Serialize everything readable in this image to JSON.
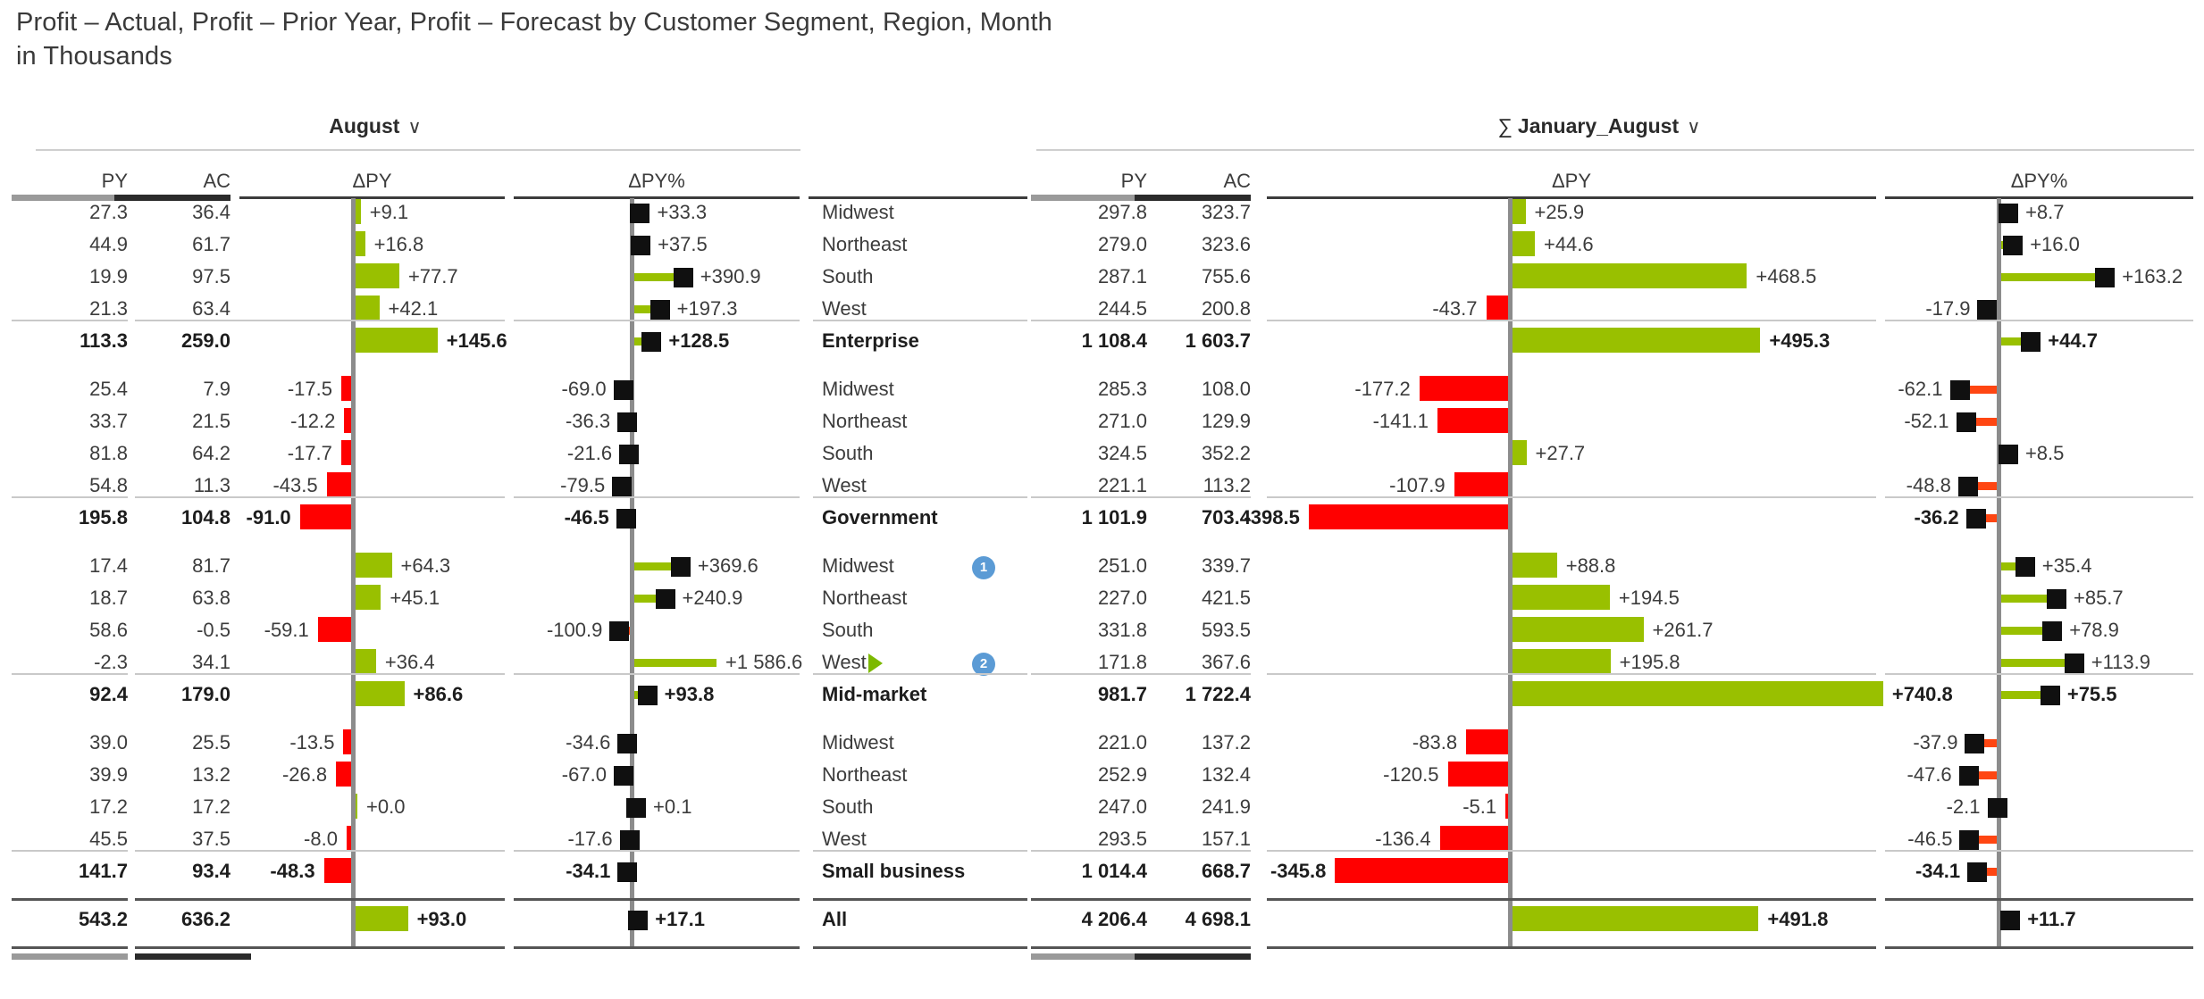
{
  "title": "Profit – Actual, Profit – Prior Year, Profit – Forecast by Customer Segment, Region, Month\nin Thousands",
  "panels": {
    "left": {
      "period_label": "August",
      "chevron": "∨",
      "sigma": "",
      "columns": {
        "py": "PY",
        "ac": "AC",
        "dpy": "ΔPY",
        "dpypct": "ΔPY%"
      }
    },
    "right": {
      "period_label": "January_August",
      "chevron": "∨",
      "sigma": "∑",
      "columns": {
        "py": "PY",
        "ac": "AC",
        "dpy": "ΔPY",
        "dpypct": "ΔPY%"
      }
    }
  },
  "chart_data": {
    "type": "bar",
    "title": "Profit – Actual, Profit – Prior Year, Profit – Forecast by Customer Segment, Region, Month",
    "subtitle": "in Thousands",
    "measures": [
      "PY",
      "AC",
      "ΔPY",
      "ΔPY%"
    ],
    "periods": [
      "August",
      "∑ January_August"
    ],
    "axis_ranges": {
      "left_dpy": [
        -100,
        160
      ],
      "left_dpypct": [
        -110,
        420
      ],
      "right_dpy": [
        -420,
        760
      ],
      "right_dpypct": [
        -70,
        175
      ]
    },
    "groups": [
      {
        "name": "Enterprise",
        "rows": [
          {
            "region": "Midwest",
            "badge": "",
            "aug_py": "27.3",
            "aug_ac": "36.4",
            "aug_dpy": "+9.1",
            "aug_dpy_v": 9.1,
            "aug_pct": "+33.3",
            "aug_pct_v": 33.3,
            "ytd_py": "297.8",
            "ytd_ac": "323.7",
            "ytd_dpy": "+25.9",
            "ytd_dpy_v": 25.9,
            "ytd_pct": "+8.7",
            "ytd_pct_v": 8.7
          },
          {
            "region": "Northeast",
            "badge": "",
            "aug_py": "44.9",
            "aug_ac": "61.7",
            "aug_dpy": "+16.8",
            "aug_dpy_v": 16.8,
            "aug_pct": "+37.5",
            "aug_pct_v": 37.5,
            "ytd_py": "279.0",
            "ytd_ac": "323.6",
            "ytd_dpy": "+44.6",
            "ytd_dpy_v": 44.6,
            "ytd_pct": "+16.0",
            "ytd_pct_v": 16.0
          },
          {
            "region": "South",
            "badge": "",
            "aug_py": "19.9",
            "aug_ac": "97.5",
            "aug_dpy": "+77.7",
            "aug_dpy_v": 77.7,
            "aug_pct": "+390.9",
            "aug_pct_v": 390.9,
            "ytd_py": "287.1",
            "ytd_ac": "755.6",
            "ytd_dpy": "+468.5",
            "ytd_dpy_v": 468.5,
            "ytd_pct": "+163.2",
            "ytd_pct_v": 163.2
          },
          {
            "region": "West",
            "badge": "",
            "aug_py": "21.3",
            "aug_ac": "63.4",
            "aug_dpy": "+42.1",
            "aug_dpy_v": 42.1,
            "aug_pct": "+197.3",
            "aug_pct_v": 197.3,
            "ytd_py": "244.5",
            "ytd_ac": "200.8",
            "ytd_dpy": "-43.7",
            "ytd_dpy_v": -43.7,
            "ytd_pct": "-17.9",
            "ytd_pct_v": -17.9
          }
        ],
        "total": {
          "label": "Enterprise",
          "aug_py": "113.3",
          "aug_ac": "259.0",
          "aug_dpy": "+145.6",
          "aug_dpy_v": 145.6,
          "aug_pct": "+128.5",
          "aug_pct_v": 128.5,
          "ytd_py": "1 108.4",
          "ytd_ac": "1 603.7",
          "ytd_dpy": "+495.3",
          "ytd_dpy_v": 495.3,
          "ytd_pct": "+44.7",
          "ytd_pct_v": 44.7
        }
      },
      {
        "name": "Government",
        "rows": [
          {
            "region": "Midwest",
            "badge": "",
            "aug_py": "25.4",
            "aug_ac": "7.9",
            "aug_dpy": "-17.5",
            "aug_dpy_v": -17.5,
            "aug_pct": "-69.0",
            "aug_pct_v": -69.0,
            "ytd_py": "285.3",
            "ytd_ac": "108.0",
            "ytd_dpy": "-177.2",
            "ytd_dpy_v": -177.2,
            "ytd_pct": "-62.1",
            "ytd_pct_v": -62.1
          },
          {
            "region": "Northeast",
            "badge": "",
            "aug_py": "33.7",
            "aug_ac": "21.5",
            "aug_dpy": "-12.2",
            "aug_dpy_v": -12.2,
            "aug_pct": "-36.3",
            "aug_pct_v": -36.3,
            "ytd_py": "271.0",
            "ytd_ac": "129.9",
            "ytd_dpy": "-141.1",
            "ytd_dpy_v": -141.1,
            "ytd_pct": "-52.1",
            "ytd_pct_v": -52.1
          },
          {
            "region": "South",
            "badge": "",
            "aug_py": "81.8",
            "aug_ac": "64.2",
            "aug_dpy": "-17.7",
            "aug_dpy_v": -17.7,
            "aug_pct": "-21.6",
            "aug_pct_v": -21.6,
            "ytd_py": "324.5",
            "ytd_ac": "352.2",
            "ytd_dpy": "+27.7",
            "ytd_dpy_v": 27.7,
            "ytd_pct": "+8.5",
            "ytd_pct_v": 8.5
          },
          {
            "region": "West",
            "badge": "",
            "aug_py": "54.8",
            "aug_ac": "11.3",
            "aug_dpy": "-43.5",
            "aug_dpy_v": -43.5,
            "aug_pct": "-79.5",
            "aug_pct_v": -79.5,
            "ytd_py": "221.1",
            "ytd_ac": "113.2",
            "ytd_dpy": "-107.9",
            "ytd_dpy_v": -107.9,
            "ytd_pct": "-48.8",
            "ytd_pct_v": -48.8
          }
        ],
        "total": {
          "label": "Government",
          "aug_py": "195.8",
          "aug_ac": "104.8",
          "aug_dpy": "-91.0",
          "aug_dpy_v": -91.0,
          "aug_pct": "-46.5",
          "aug_pct_v": -46.5,
          "ytd_py": "1 101.9",
          "ytd_ac": "703.4",
          "ytd_dpy": "-398.5",
          "ytd_dpy_v": -398.5,
          "ytd_pct": "-36.2",
          "ytd_pct_v": -36.2
        }
      },
      {
        "name": "Mid-market",
        "rows": [
          {
            "region": "Midwest",
            "badge": "1",
            "aug_py": "17.4",
            "aug_ac": "81.7",
            "aug_dpy": "+64.3",
            "aug_dpy_v": 64.3,
            "aug_pct": "+369.6",
            "aug_pct_v": 369.6,
            "ytd_py": "251.0",
            "ytd_ac": "339.7",
            "ytd_dpy": "+88.8",
            "ytd_dpy_v": 88.8,
            "ytd_pct": "+35.4",
            "ytd_pct_v": 35.4
          },
          {
            "region": "Northeast",
            "badge": "",
            "aug_py": "18.7",
            "aug_ac": "63.8",
            "aug_dpy": "+45.1",
            "aug_dpy_v": 45.1,
            "aug_pct": "+240.9",
            "aug_pct_v": 240.9,
            "ytd_py": "227.0",
            "ytd_ac": "421.5",
            "ytd_dpy": "+194.5",
            "ytd_dpy_v": 194.5,
            "ytd_pct": "+85.7",
            "ytd_pct_v": 85.7
          },
          {
            "region": "South",
            "badge": "",
            "aug_py": "58.6",
            "aug_ac": "-0.5",
            "aug_dpy": "-59.1",
            "aug_dpy_v": -59.1,
            "aug_pct": "-100.9",
            "aug_pct_v": -100.9,
            "ytd_py": "331.8",
            "ytd_ac": "593.5",
            "ytd_dpy": "+261.7",
            "ytd_dpy_v": 261.7,
            "ytd_pct": "+78.9",
            "ytd_pct_v": 78.9
          },
          {
            "region": "West",
            "badge": "2",
            "aug_py": "-2.3",
            "aug_ac": "34.1",
            "aug_dpy": "+36.4",
            "aug_dpy_v": 36.4,
            "aug_pct": "+1 586.6",
            "aug_pct_v": 1586.6,
            "aug_pct_overflow": true,
            "ytd_py": "171.8",
            "ytd_ac": "367.6",
            "ytd_dpy": "+195.8",
            "ytd_dpy_v": 195.8,
            "ytd_pct": "+113.9",
            "ytd_pct_v": 113.9
          }
        ],
        "total": {
          "label": "Mid-market",
          "aug_py": "92.4",
          "aug_ac": "179.0",
          "aug_dpy": "+86.6",
          "aug_dpy_v": 86.6,
          "aug_pct": "+93.8",
          "aug_pct_v": 93.8,
          "ytd_py": "981.7",
          "ytd_ac": "1 722.4",
          "ytd_dpy": "+740.8",
          "ytd_dpy_v": 740.8,
          "ytd_pct": "+75.5",
          "ytd_pct_v": 75.5
        }
      },
      {
        "name": "Small business",
        "rows": [
          {
            "region": "Midwest",
            "badge": "",
            "aug_py": "39.0",
            "aug_ac": "25.5",
            "aug_dpy": "-13.5",
            "aug_dpy_v": -13.5,
            "aug_pct": "-34.6",
            "aug_pct_v": -34.6,
            "ytd_py": "221.0",
            "ytd_ac": "137.2",
            "ytd_dpy": "-83.8",
            "ytd_dpy_v": -83.8,
            "ytd_pct": "-37.9",
            "ytd_pct_v": -37.9
          },
          {
            "region": "Northeast",
            "badge": "",
            "aug_py": "39.9",
            "aug_ac": "13.2",
            "aug_dpy": "-26.8",
            "aug_dpy_v": -26.8,
            "aug_pct": "-67.0",
            "aug_pct_v": -67.0,
            "ytd_py": "252.9",
            "ytd_ac": "132.4",
            "ytd_dpy": "-120.5",
            "ytd_dpy_v": -120.5,
            "ytd_pct": "-47.6",
            "ytd_pct_v": -47.6
          },
          {
            "region": "South",
            "badge": "",
            "aug_py": "17.2",
            "aug_ac": "17.2",
            "aug_dpy": "+0.0",
            "aug_dpy_v": 0.0,
            "aug_pct": "+0.1",
            "aug_pct_v": 0.1,
            "ytd_py": "247.0",
            "ytd_ac": "241.9",
            "ytd_dpy": "-5.1",
            "ytd_dpy_v": -5.1,
            "ytd_pct": "-2.1",
            "ytd_pct_v": -2.1
          },
          {
            "region": "West",
            "badge": "",
            "aug_py": "45.5",
            "aug_ac": "37.5",
            "aug_dpy": "-8.0",
            "aug_dpy_v": -8.0,
            "aug_pct": "-17.6",
            "aug_pct_v": -17.6,
            "ytd_py": "293.5",
            "ytd_ac": "157.1",
            "ytd_dpy": "-136.4",
            "ytd_dpy_v": -136.4,
            "ytd_pct": "-46.5",
            "ytd_pct_v": -46.5
          }
        ],
        "total": {
          "label": "Small business",
          "aug_py": "141.7",
          "aug_ac": "93.4",
          "aug_dpy": "-48.3",
          "aug_dpy_v": -48.3,
          "aug_pct": "-34.1",
          "aug_pct_v": -34.1,
          "ytd_py": "1 014.4",
          "ytd_ac": "668.7",
          "ytd_dpy": "-345.8",
          "ytd_dpy_v": -345.8,
          "ytd_pct": "-34.1",
          "ytd_pct_v": -34.1
        }
      }
    ],
    "grand_total": {
      "label": "All",
      "aug_py": "543.2",
      "aug_ac": "636.2",
      "aug_dpy": "+93.0",
      "aug_dpy_v": 93.0,
      "aug_pct": "+17.1",
      "aug_pct_v": 17.1,
      "ytd_py": "4 206.4",
      "ytd_ac": "4 698.1",
      "ytd_dpy": "+491.8",
      "ytd_dpy_v": 491.8,
      "ytd_pct": "+11.7",
      "ytd_pct_v": 11.7
    },
    "colors": {
      "positive": "#99c000",
      "negative": "#ff0000",
      "pct_negative": "#ff4612",
      "marker": "#101010",
      "axis": "#8c8c8c",
      "py_header": "#9a9a9a",
      "ac_header": "#2b2b2b",
      "badge": "#5b9bd5"
    }
  }
}
